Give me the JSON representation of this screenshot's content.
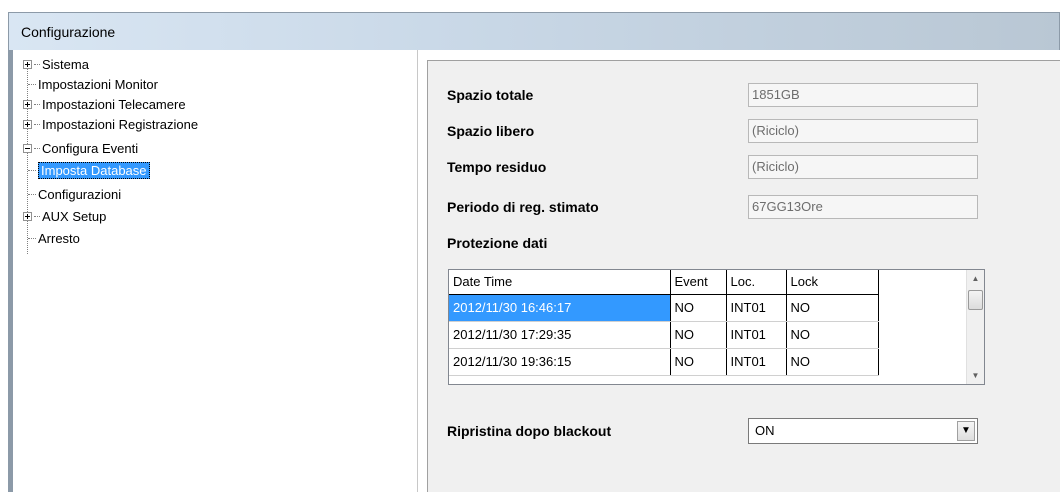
{
  "window": {
    "title": "Configurazione"
  },
  "tree": {
    "items": [
      {
        "label": "Sistema",
        "expander": "plus"
      },
      {
        "label": "Impostazioni Monitor",
        "expander": "none"
      },
      {
        "label": "Impostazioni Telecamere",
        "expander": "plus"
      },
      {
        "label": "Impostazioni Registrazione",
        "expander": "plus"
      },
      {
        "label": "Configura Eventi",
        "expander": "minus"
      },
      {
        "label": "Imposta Database",
        "expander": "none",
        "selected": true
      },
      {
        "label": "Configurazioni",
        "expander": "none"
      },
      {
        "label": "AUX Setup",
        "expander": "plus"
      },
      {
        "label": "Arresto",
        "expander": "none"
      }
    ]
  },
  "database": {
    "total_space": {
      "label": "Spazio totale",
      "value": "1851GB"
    },
    "free_space": {
      "label": "Spazio libero",
      "value": "(Riciclo)"
    },
    "remaining_time": {
      "label": "Tempo residuo",
      "value": "(Riciclo)"
    },
    "estimated_period": {
      "label": "Periodo di reg. stimato",
      "value": "67GG13Ore"
    },
    "protection_title": "Protezione dati",
    "grid": {
      "headers": [
        "Date Time",
        "Event",
        "Loc.",
        "Lock"
      ],
      "rows": [
        {
          "date": "2012/11/30 16:46:17",
          "event": "NO",
          "loc": "INT01",
          "lock": "NO",
          "selected": true
        },
        {
          "date": "2012/11/30 17:29:35",
          "event": "NO",
          "loc": "INT01",
          "lock": "NO"
        },
        {
          "date": "2012/11/30 19:36:15",
          "event": "NO",
          "loc": "INT01",
          "lock": "NO"
        }
      ]
    },
    "blackout": {
      "label": "Ripristina dopo blackout",
      "value": "ON"
    }
  },
  "icons": {
    "scroll_up": "scroll-up-arrow-icon",
    "scroll_down": "scroll-down-arrow-icon",
    "dropdown": "chevron-down-icon"
  },
  "colors": {
    "selection": "#3399ff",
    "panel": "#f0f0f0",
    "titlebar": "#cad9e8"
  }
}
